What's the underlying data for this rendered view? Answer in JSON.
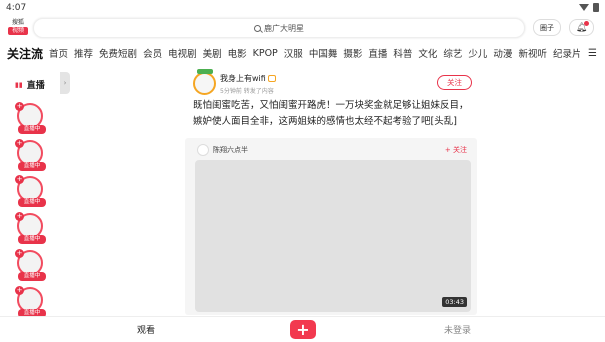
{
  "status_bar": {
    "time": "4:07",
    "icons": [
      "wifi-icon",
      "battery-icon"
    ]
  },
  "top_bar": {
    "logo_line1": "搜狐",
    "logo_line2": "视频",
    "search_placeholder": "鹿广大明星",
    "circle_button": "圈子",
    "bell_icon": "bell-icon"
  },
  "tabs": {
    "active": "关注流",
    "items": [
      "首页",
      "推荐",
      "免费短剧",
      "会员",
      "电视剧",
      "美剧",
      "电影",
      "KPOP",
      "汉服",
      "中国舞",
      "摄影",
      "直播",
      "科普",
      "文化",
      "综艺",
      "少儿",
      "动漫",
      "新视听",
      "纪录片"
    ],
    "more_icon": "☰"
  },
  "sidebar": {
    "title": "直播",
    "live_badge": "直播中",
    "collapse_icon": "›"
  },
  "post": {
    "author": "我身上有wifi",
    "meta": "5分钟前 转发了内容",
    "follow_label": "关注",
    "text": "既怕闺蜜吃苦，又怕闺蜜开路虎！一万块奖金就足够让姐妹反目，嫉妒使人面目全非，这两姐妹的感情也太经不起考验了吧[头乱]",
    "repost": {
      "author": "陈翔六点半",
      "follow_label": "+ 关注",
      "duration": "03:43"
    }
  },
  "bottom_bar": {
    "watch_label": "观看",
    "add_icon": "+",
    "login_label": "未登录"
  },
  "colors": {
    "accent": "#e8334a",
    "avatar_ring": "#f5a623"
  }
}
